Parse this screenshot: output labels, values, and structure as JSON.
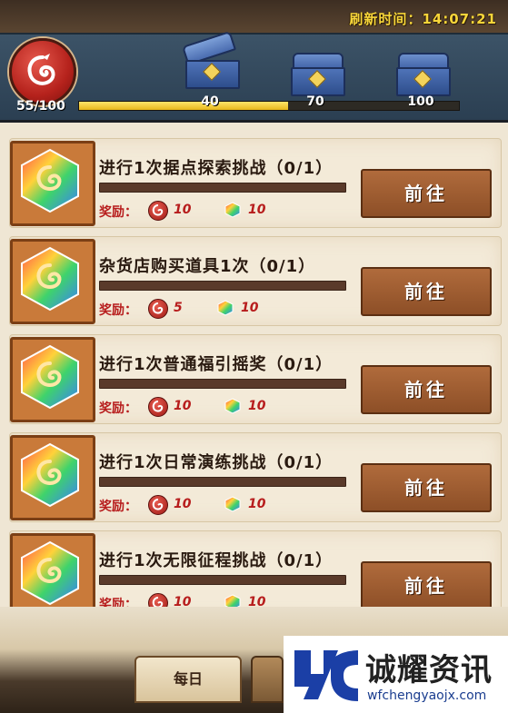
{
  "header": {
    "refresh_text": "刷新时间：14:07:21"
  },
  "activity": {
    "points_text": "55/100",
    "progress_fraction": 0.55,
    "milestones": [
      {
        "value": "40",
        "state": "opened"
      },
      {
        "value": "70",
        "state": "closed"
      },
      {
        "value": "100",
        "state": "closed"
      }
    ]
  },
  "tasks": [
    {
      "title": "进行1次据点探索挑战（0/1）",
      "reward_label": "奖励：",
      "reward_coin": "10",
      "reward_gem": "10",
      "button": "前往"
    },
    {
      "title": "杂货店购买道具1次（0/1）",
      "reward_label": "奖励：",
      "reward_coin": "5",
      "reward_gem": "10",
      "button": "前往"
    },
    {
      "title": "进行1次普通福引摇奖（0/1）",
      "reward_label": "奖励：",
      "reward_coin": "10",
      "reward_gem": "10",
      "button": "前往"
    },
    {
      "title": "进行1次日常演练挑战（0/1）",
      "reward_label": "奖励：",
      "reward_coin": "10",
      "reward_gem": "10",
      "button": "前往"
    },
    {
      "title": "进行1次无限征程挑战（0/1）",
      "reward_label": "奖励：",
      "reward_coin": "10",
      "reward_gem": "10",
      "button": "前往"
    }
  ],
  "tabs": {
    "daily": "每日"
  },
  "watermark": {
    "name": "诚耀资讯",
    "url": "wfchengyaojx.com"
  },
  "colors": {
    "accent_red": "#b71c1c",
    "button_brown": "#9b5a2f",
    "progress_yellow": "#f2cf2f"
  }
}
